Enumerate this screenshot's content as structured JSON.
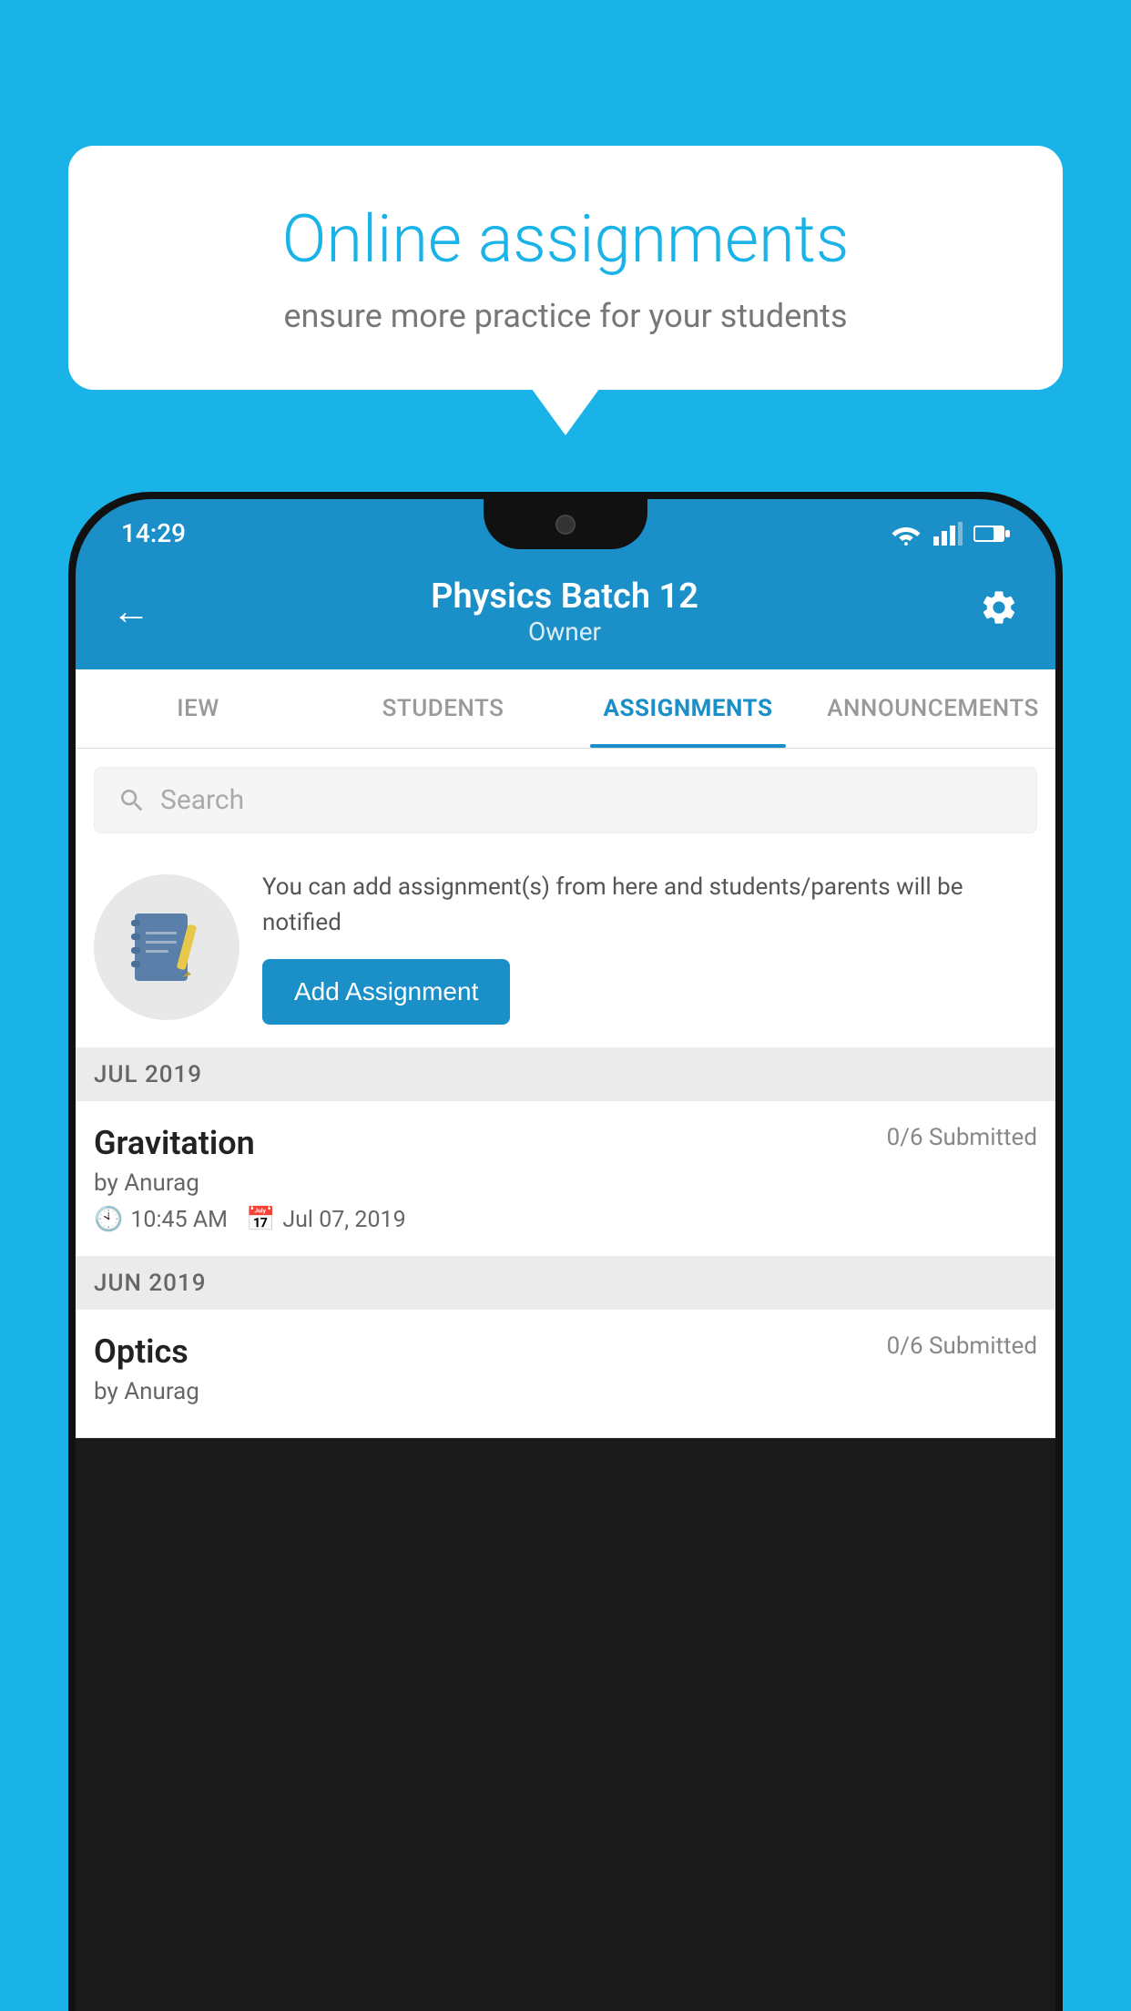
{
  "background": {
    "color": "#1ab3e8"
  },
  "speech_bubble": {
    "title": "Online assignments",
    "subtitle": "ensure more practice for your students"
  },
  "status_bar": {
    "time": "14:29"
  },
  "header": {
    "title": "Physics Batch 12",
    "subtitle": "Owner",
    "back_label": "←",
    "settings_label": "⚙"
  },
  "tabs": [
    {
      "label": "IEW",
      "active": false
    },
    {
      "label": "STUDENTS",
      "active": false
    },
    {
      "label": "ASSIGNMENTS",
      "active": true
    },
    {
      "label": "ANNOUNCEMENTS",
      "active": false
    }
  ],
  "search": {
    "placeholder": "Search"
  },
  "promo": {
    "description": "You can add assignment(s) from here and students/parents will be notified",
    "button_label": "Add Assignment"
  },
  "sections": [
    {
      "month": "JUL 2019",
      "assignments": [
        {
          "name": "Gravitation",
          "submitted": "0/6 Submitted",
          "by": "by Anurag",
          "time": "10:45 AM",
          "date": "Jul 07, 2019"
        }
      ]
    },
    {
      "month": "JUN 2019",
      "assignments": [
        {
          "name": "Optics",
          "submitted": "0/6 Submitted",
          "by": "by Anurag",
          "time": "",
          "date": ""
        }
      ]
    }
  ]
}
